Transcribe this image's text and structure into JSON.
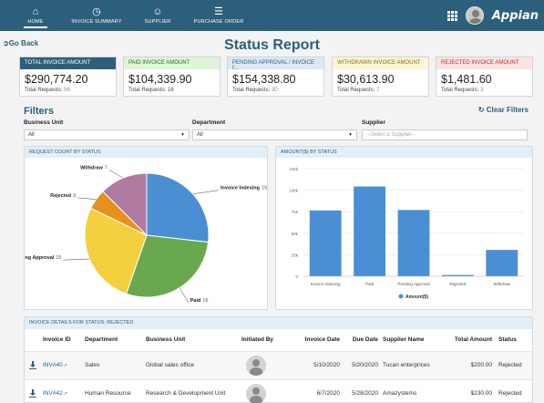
{
  "nav": {
    "tabs": [
      {
        "label": "HOME",
        "icon": "home-icon"
      },
      {
        "label": "INVOICE SUMMARY",
        "icon": "invoice-icon"
      },
      {
        "label": "SUPPLIER",
        "icon": "supplier-icon"
      },
      {
        "label": "PURCHASE ORDER",
        "icon": "purchase-order-icon"
      }
    ],
    "brand": "Appian"
  },
  "header": {
    "go_back": "Go Back",
    "title": "Status Report"
  },
  "cards": [
    {
      "label": "TOTAL INVOICE AMOUNT",
      "amount": "$290,774.20",
      "req_label": "Total Requests:",
      "req_value": "56",
      "color": "#2c5f7c"
    },
    {
      "label": "PAID INVOICE AMOUNT",
      "amount": "$104,339.90",
      "req_label": "Total Requests:",
      "req_value": "16",
      "color": "#dff5d8"
    },
    {
      "label": "PENDING APPROVAL / INVOICE I...",
      "amount": "$154,338.80",
      "req_label": "Total Requests:",
      "req_value": "30",
      "color": "#dbe9f7"
    },
    {
      "label": "WITHDRAWN INVOICE AMOUNT",
      "amount": "$30,613.90",
      "req_label": "Total Requests:",
      "req_value": "7",
      "color": "#fbf6d4"
    },
    {
      "label": "REJECTED INVOICE AMOUNT",
      "amount": "$1,481.60",
      "req_label": "Total Requests:",
      "req_value": "3",
      "color": "#fde3e3"
    }
  ],
  "filters": {
    "title": "Filters",
    "clear": "Clear Filters",
    "business_unit": {
      "label": "Business Unit",
      "value": "All"
    },
    "department": {
      "label": "Department",
      "value": "All"
    },
    "supplier": {
      "label": "Supplier",
      "placeholder": "--Select a Supplier--"
    }
  },
  "pie_panel": {
    "title": "REQUEST COUNT BY STATUS"
  },
  "bar_panel": {
    "title": "AMOUNT($) BY STATUS"
  },
  "chart_data": [
    {
      "type": "pie",
      "title": "REQUEST COUNT BY STATUS",
      "categories": [
        "Invoice Indexing",
        "Paid",
        "Pending Approval",
        "Rejected",
        "Withdraw"
      ],
      "values": [
        15,
        16,
        15,
        3,
        7
      ],
      "colors": [
        "#4a8fd4",
        "#6aa84f",
        "#f4d03f",
        "#e8901e",
        "#b07aa1"
      ]
    },
    {
      "type": "bar",
      "title": "AMOUNT($) BY STATUS",
      "categories": [
        "Invoice Indexing",
        "Paid",
        "Pending Approval",
        "Rejected",
        "Withdraw"
      ],
      "series": [
        {
          "name": "Amount($)",
          "values": [
            76500,
            104339.9,
            77000,
            1481.6,
            30613.9
          ],
          "color": "#4a8fd4"
        }
      ],
      "ylim": [
        0,
        125000
      ],
      "yticks": [
        "0",
        "25k",
        "50k",
        "75k",
        "100k",
        "125k"
      ],
      "legend": "bottom"
    }
  ],
  "table": {
    "title": "INVOICE DETAILS FOR STATUS: REJECTED",
    "columns": [
      "Invoice ID",
      "Department",
      "Business Unit",
      "Initiated By",
      "Invoice Date",
      "Due Date",
      "Supplier Name",
      "Total Amount",
      "Status"
    ],
    "rows": [
      {
        "id": "INV#40",
        "department": "Sales",
        "business_unit": "Global sales office",
        "invoice_date": "5/10/2020",
        "due_date": "5/20/2020",
        "supplier": "Tucan enterprices",
        "total": "$200.00",
        "status": "Rejected"
      },
      {
        "id": "INV#42",
        "department": "Human Resource",
        "business_unit": "Research & Development Unit",
        "invoice_date": "6/7/2020",
        "due_date": "5/28/2020",
        "supplier": "Amazystems",
        "total": "$230.00",
        "status": "Rejected"
      }
    ]
  }
}
